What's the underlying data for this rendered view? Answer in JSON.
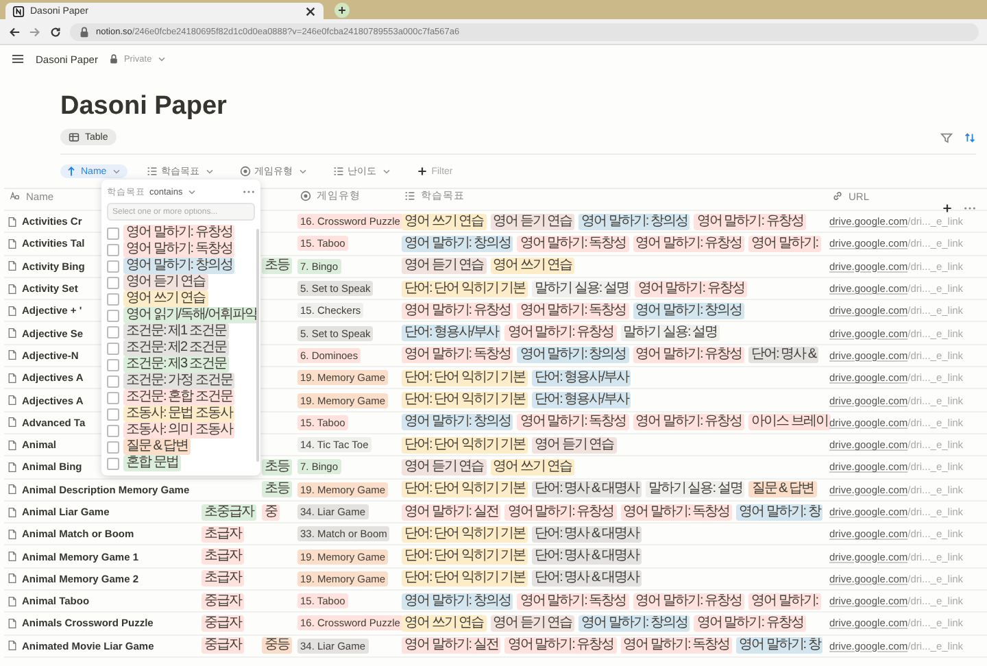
{
  "browser": {
    "tab_title": "Dasoni Paper",
    "url_host": "notion.so",
    "url_path": "/246e0fcbe24180695f82d1c0d0ea0888?v=246e0fcba24180789553a000c7fa567a6"
  },
  "topbar": {
    "breadcrumb": "Dasoni Paper",
    "privacy": "Private"
  },
  "page": {
    "title": "Dasoni Paper",
    "views": [
      {
        "label": "Table",
        "selected": true
      }
    ]
  },
  "filters": [
    {
      "kind": "sort",
      "label": "Name"
    },
    {
      "kind": "multi",
      "label": "학습목표"
    },
    {
      "kind": "select",
      "label": "게임유형"
    },
    {
      "kind": "multi",
      "label": "난이도"
    },
    {
      "kind": "add",
      "label": "Filter"
    }
  ],
  "table": {
    "columns": [
      {
        "kind": "title",
        "label": "Name"
      },
      {
        "kind": "select",
        "label": "게임유형"
      },
      {
        "kind": "multi",
        "label": "학습목표"
      },
      {
        "kind": "url",
        "label": "URL"
      }
    ],
    "rows": [
      {
        "name": "Activities Cr",
        "game": {
          "text": "16. Crossword Puzzle",
          "color": "#ffe2dd"
        },
        "goals": [
          {
            "text": "영어 쓰기 연습",
            "color": "#fdecc8"
          },
          {
            "text": "영어 듣기 연습",
            "color": "#f1e2de"
          },
          {
            "text": "영어 말하기: 창의성",
            "color": "#d3e5ef"
          },
          {
            "text": "영어 말하기: 유창성",
            "color": "#ffe2dd"
          }
        ],
        "url": {
          "host": "drive.google.com",
          "path": "/dri..._e_link"
        }
      },
      {
        "name": "Activities Tal",
        "game": {
          "text": "15. Taboo",
          "color": "#ffe2dd"
        },
        "goals": [
          {
            "text": "영어 말하기: 창의성",
            "color": "#d3e5ef"
          },
          {
            "text": "영어 말하기: 독창성",
            "color": "#ffe2dd"
          },
          {
            "text": "영어 말하기: 유창성",
            "color": "#ffe2dd"
          },
          {
            "text": "영어 말하기:",
            "color": "#ffe2dd"
          }
        ],
        "url": {
          "host": "drive.google.com",
          "path": "/dri..._e_link"
        }
      },
      {
        "name": "Activity Bing",
        "column_3": {
          "text": "초등",
          "color": "#dbeddb"
        },
        "game": {
          "text": "7. Bingo",
          "color": "#dbeddb"
        },
        "goals": [
          {
            "text": "영어 듣기 연습",
            "color": "#f1e2de"
          },
          {
            "text": "영어 쓰기 연습",
            "color": "#fdecc8"
          }
        ],
        "url": {
          "host": "drive.google.com",
          "path": "/dri..._e_link"
        }
      },
      {
        "name": "Activity Set",
        "game": {
          "text": "5. Set to Speak",
          "color": "#e3e2e0"
        },
        "goals": [
          {
            "text": "단어: 단어 익히기 기본",
            "color": "#fdecc8"
          },
          {
            "text": "말하기 실용: 설명",
            "color": "#efefed"
          },
          {
            "text": "영어 말하기: 유창성",
            "color": "#ffe2dd"
          }
        ],
        "url": {
          "host": "drive.google.com",
          "path": "/dri..._e_link"
        }
      },
      {
        "name": "Adjective + '",
        "game": {
          "text": "15. Checkers",
          "color": "#efefed"
        },
        "goals": [
          {
            "text": "영어 말하기: 유창성",
            "color": "#ffe2dd"
          },
          {
            "text": "영어 말하기: 독창성",
            "color": "#ffe2dd"
          },
          {
            "text": "영어 말하기: 창의성",
            "color": "#d3e5ef"
          }
        ],
        "url": {
          "host": "drive.google.com",
          "path": "/dri..._e_link"
        }
      },
      {
        "name": "Adjective Se",
        "game": {
          "text": "5. Set to Speak",
          "color": "#e3e2e0"
        },
        "goals": [
          {
            "text": "단어: 형용사/부사",
            "color": "#d3e5ef"
          },
          {
            "text": "영어 말하기: 유창성",
            "color": "#ffe2dd"
          },
          {
            "text": "말하기 실용: 설명",
            "color": "#efefed"
          }
        ],
        "url": {
          "host": "drive.google.com",
          "path": "/dri..._e_link"
        }
      },
      {
        "name": "Adjective-N",
        "game": {
          "text": "6. Dominoes",
          "color": "#ffe2dd"
        },
        "goals": [
          {
            "text": "영어 말하기: 독창성",
            "color": "#ffe2dd"
          },
          {
            "text": "영어 말하기: 창의성",
            "color": "#d3e5ef"
          },
          {
            "text": "영어 말하기: 유창성",
            "color": "#ffe2dd"
          },
          {
            "text": "단어: 명사 &",
            "color": "#e3e2e0"
          }
        ],
        "url": {
          "host": "drive.google.com",
          "path": "/dri..._e_link"
        }
      },
      {
        "name": "Adjectives A",
        "game": {
          "text": "19. Memory Game",
          "color": "#fadec9"
        },
        "goals": [
          {
            "text": "단어: 단어 익히기 기본",
            "color": "#fdecc8"
          },
          {
            "text": "단어: 형용사/부사",
            "color": "#d3e5ef"
          }
        ],
        "url": {
          "host": "drive.google.com",
          "path": "/dri..._e_link"
        }
      },
      {
        "name": "Adjectives A",
        "game": {
          "text": "19. Memory Game",
          "color": "#fadec9"
        },
        "goals": [
          {
            "text": "단어: 단어 익히기 기본",
            "color": "#fdecc8"
          },
          {
            "text": "단어: 형용사/부사",
            "color": "#d3e5ef"
          }
        ],
        "url": {
          "host": "drive.google.com",
          "path": "/dri..._e_link"
        }
      },
      {
        "name": "Advanced Ta",
        "game": {
          "text": "15. Taboo",
          "color": "#ffe2dd"
        },
        "goals": [
          {
            "text": "영어 말하기: 창의성",
            "color": "#d3e5ef"
          },
          {
            "text": "영어 말하기: 독창성",
            "color": "#ffe2dd"
          },
          {
            "text": "영어 말하기: 유창성",
            "color": "#ffe2dd"
          },
          {
            "text": "아이스 브레이",
            "color": "#ffe2dd"
          }
        ],
        "url": {
          "host": "drive.google.com",
          "path": "/dri..._e_link"
        }
      },
      {
        "name": "Animal",
        "game": {
          "text": "14. Tic Tac Toe",
          "color": "#efefed"
        },
        "goals": [
          {
            "text": "단어: 단어 익히기 기본",
            "color": "#fdecc8"
          },
          {
            "text": "영어 듣기 연습",
            "color": "#f1e2de"
          }
        ],
        "url": {
          "host": "drive.google.com",
          "path": "/dri..._e_link"
        }
      },
      {
        "name": "Animal Bing",
        "column_3": {
          "text": "초등",
          "color": "#dbeddb"
        },
        "game": {
          "text": "7. Bingo",
          "color": "#dbeddb"
        },
        "goals": [
          {
            "text": "영어 듣기 연습",
            "color": "#f1e2de"
          },
          {
            "text": "영어 쓰기 연습",
            "color": "#fdecc8"
          }
        ],
        "url": {
          "host": "drive.google.com",
          "path": "/dri..._e_link"
        }
      },
      {
        "name": "Animal Description Memory Game",
        "column_3": {
          "text": "초등",
          "color": "#dbeddb"
        },
        "game": {
          "text": "19. Memory Game",
          "color": "#fadec9"
        },
        "goals": [
          {
            "text": "단어: 단어 익히기 기본",
            "color": "#fdecc8"
          },
          {
            "text": "단어: 명사 & 대명사",
            "color": "#e3e2e0"
          },
          {
            "text": "말하기 실용: 설명",
            "color": "#efefed"
          },
          {
            "text": "질문 & 답변",
            "color": "#fadec9"
          }
        ],
        "url": {
          "host": "drive.google.com",
          "path": "/dri..._e_link"
        }
      },
      {
        "name": "Animal Liar Game",
        "column_2": {
          "text": "초중급자",
          "color": "#dbeddb"
        },
        "column_3": {
          "text": "중",
          "color": "#ffe2dd"
        },
        "game": {
          "text": "34. Liar Game",
          "color": "#e3e2e0"
        },
        "goals": [
          {
            "text": "영어 말하기: 실전",
            "color": "#ffe2dd"
          },
          {
            "text": "영어 말하기: 유창성",
            "color": "#ffe2dd"
          },
          {
            "text": "영어 말하기: 독창성",
            "color": "#ffe2dd"
          },
          {
            "text": "영어 말하기: 창",
            "color": "#d3e5ef"
          }
        ],
        "url": {
          "host": "drive.google.com",
          "path": "/dri..._e_link"
        }
      },
      {
        "name": "Animal Match or Boom",
        "column_2": {
          "text": "초급자",
          "color": "#ffe2dd"
        },
        "game": {
          "text": "33. Match or Boom",
          "color": "#e3e2e0"
        },
        "goals": [
          {
            "text": "단어: 단어 익히기 기본",
            "color": "#fdecc8"
          },
          {
            "text": "단어: 명사 & 대명사",
            "color": "#e3e2e0"
          }
        ],
        "url": {
          "host": "drive.google.com",
          "path": "/dri..._e_link"
        }
      },
      {
        "name": "Animal Memory Game 1",
        "column_2": {
          "text": "초급자",
          "color": "#ffe2dd"
        },
        "game": {
          "text": "19. Memory Game",
          "color": "#fadec9"
        },
        "goals": [
          {
            "text": "단어: 단어 익히기 기본",
            "color": "#fdecc8"
          },
          {
            "text": "단어: 명사 & 대명사",
            "color": "#e3e2e0"
          }
        ],
        "url": {
          "host": "drive.google.com",
          "path": "/dri..._e_link"
        }
      },
      {
        "name": "Animal Memory Game 2",
        "column_2": {
          "text": "초급자",
          "color": "#ffe2dd"
        },
        "game": {
          "text": "19. Memory Game",
          "color": "#fadec9"
        },
        "goals": [
          {
            "text": "단어: 단어 익히기 기본",
            "color": "#fdecc8"
          },
          {
            "text": "단어: 명사 & 대명사",
            "color": "#e3e2e0"
          }
        ],
        "url": {
          "host": "drive.google.com",
          "path": "/dri..._e_link"
        }
      },
      {
        "name": "Animal Taboo",
        "column_2": {
          "text": "중급자",
          "color": "#ffe2dd"
        },
        "game": {
          "text": "15. Taboo",
          "color": "#ffe2dd"
        },
        "goals": [
          {
            "text": "영어 말하기: 창의성",
            "color": "#d3e5ef"
          },
          {
            "text": "영어 말하기: 독창성",
            "color": "#ffe2dd"
          },
          {
            "text": "영어 말하기: 유창성",
            "color": "#ffe2dd"
          },
          {
            "text": "영어 말하기:",
            "color": "#ffe2dd"
          }
        ],
        "url": {
          "host": "drive.google.com",
          "path": "/dri..._e_link"
        }
      },
      {
        "name": "Animals Crossword Puzzle",
        "column_2": {
          "text": "중급자",
          "color": "#ffe2dd"
        },
        "game": {
          "text": "16. Crossword Puzzle",
          "color": "#ffe2dd"
        },
        "goals": [
          {
            "text": "영어 쓰기 연습",
            "color": "#fdecc8"
          },
          {
            "text": "영어 듣기 연습",
            "color": "#f1e2de"
          },
          {
            "text": "영어 말하기: 창의성",
            "color": "#d3e5ef"
          },
          {
            "text": "영어 말하기: 유창성",
            "color": "#ffe2dd"
          }
        ],
        "url": {
          "host": "drive.google.com",
          "path": "/dri..._e_link"
        }
      },
      {
        "name": "Animated Movie Liar Game",
        "column_2": {
          "text": "중급자",
          "color": "#ffe2dd"
        },
        "column_3": {
          "text": "중등",
          "color": "#fadec9"
        },
        "game": {
          "text": "34. Liar Game",
          "color": "#e3e2e0"
        },
        "goals": [
          {
            "text": "영어 말하기: 실전",
            "color": "#ffe2dd"
          },
          {
            "text": "영어 말하기: 유창성",
            "color": "#ffe2dd"
          },
          {
            "text": "영어 말하기: 독창성",
            "color": "#ffe2dd"
          },
          {
            "text": "영어 말하기: 창",
            "color": "#d3e5ef"
          }
        ],
        "url": {
          "host": "drive.google.com",
          "path": "/dri..._e_link"
        }
      }
    ]
  },
  "filter_popup": {
    "property": "학습목표",
    "operator": "contains",
    "placeholder": "Select one or more options...",
    "options": [
      {
        "text": "영어 말하기: 유창성",
        "color": "#ffe2dd",
        "checked": false
      },
      {
        "text": "영어 말하기: 독창성",
        "color": "#ffe2dd",
        "checked": false
      },
      {
        "text": "영어 말하기: 창의성",
        "color": "#d3e5ef",
        "checked": false
      },
      {
        "text": "영어 듣기 연습",
        "color": "#f1e2de",
        "checked": false
      },
      {
        "text": "영어 쓰기 연습",
        "color": "#fdecc8",
        "checked": false
      },
      {
        "text": "영어 읽기/독해/어휘파악",
        "color": "#dbeddb",
        "checked": false
      },
      {
        "text": "조건문: 제1 조건문",
        "color": "#e3e2e0",
        "checked": false
      },
      {
        "text": "조건문: 제2 조건문",
        "color": "#e3e2e0",
        "checked": false
      },
      {
        "text": "조건문: 제3 조건문",
        "color": "#dbeddb",
        "checked": false
      },
      {
        "text": "조건문: 가정 조건문",
        "color": "#e3e2e0",
        "checked": false
      },
      {
        "text": "조건문: 혼합 조건문",
        "color": "#ffe2dd",
        "checked": false
      },
      {
        "text": "조동사: 문법 조동사",
        "color": "#fdecc8",
        "checked": false
      },
      {
        "text": "조동사: 의미 조동사",
        "color": "#ffe2dd",
        "checked": false
      },
      {
        "text": "질문 & 답변",
        "color": "#fadec9",
        "checked": false
      },
      {
        "text": "혼합 문법",
        "color": "#dbeddb",
        "checked": false
      }
    ]
  }
}
